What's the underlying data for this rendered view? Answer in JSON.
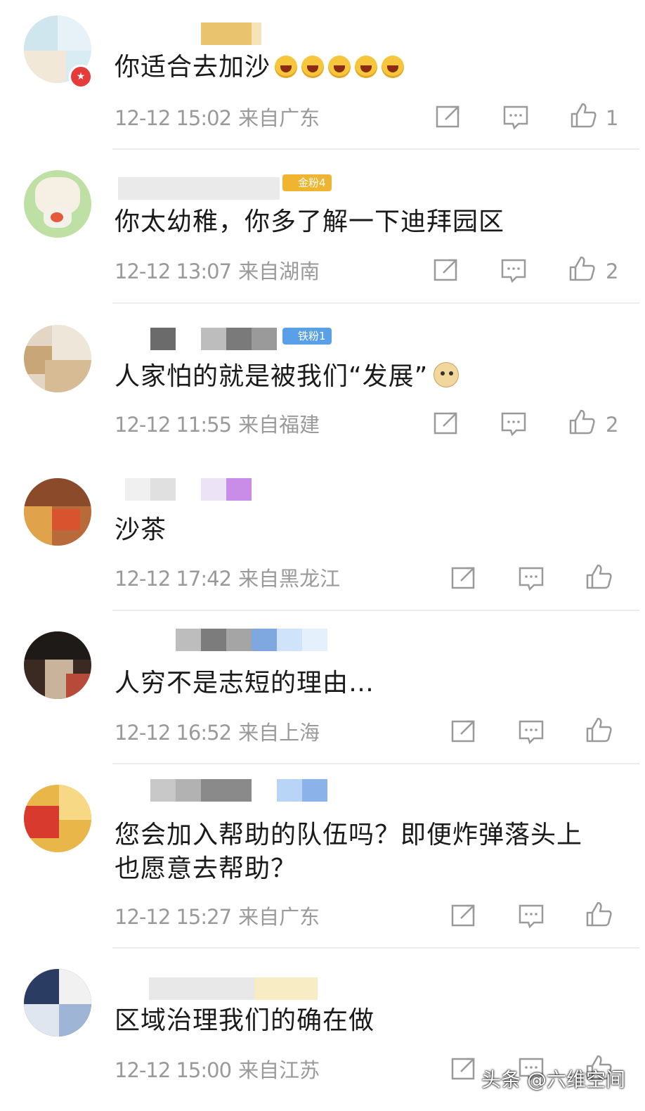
{
  "comments": [
    {
      "text": "你适合去加沙",
      "time": "12-12 15:02",
      "location": "来自广东",
      "likes": "1",
      "emoji_count": 5
    },
    {
      "text": "你太幼稚，你多了解一下迪拜园区",
      "time": "12-12 13:07",
      "location": "来自湖南",
      "likes": "2",
      "level": "金粉4"
    },
    {
      "text": "人家怕的就是被我们“发展”",
      "time": "12-12 11:55",
      "location": "来自福建",
      "likes": "2",
      "level": "铁粉1"
    },
    {
      "text": "沙茶",
      "time": "12-12 17:42",
      "location": "来自黑龙江",
      "likes": ""
    },
    {
      "text": "人穷不是志短的理由…",
      "time": "12-12 16:52",
      "location": "来自上海",
      "likes": ""
    },
    {
      "text": "您会加入帮助的队伍吗？即便炸弹落头上也愿意去帮助？",
      "time": "12-12 15:27",
      "location": "来自广东",
      "likes": ""
    },
    {
      "text": "区域治理我们的确在做",
      "time": "12-12 15:00",
      "location": "来自江苏",
      "likes": ""
    }
  ],
  "icons": {
    "share": "share-icon",
    "reply": "reply-icon",
    "like": "thumbs-up-icon",
    "emoji": "laughing-emoji-icon",
    "doge": "doge-emoji-icon"
  },
  "watermark": "头条 @六维空间",
  "colors": {
    "text": "#1a1a1a",
    "meta": "#9a9a9a",
    "divider": "#ececec",
    "gold_badge": "#f0b530",
    "blue_badge": "#5aa0e8"
  }
}
